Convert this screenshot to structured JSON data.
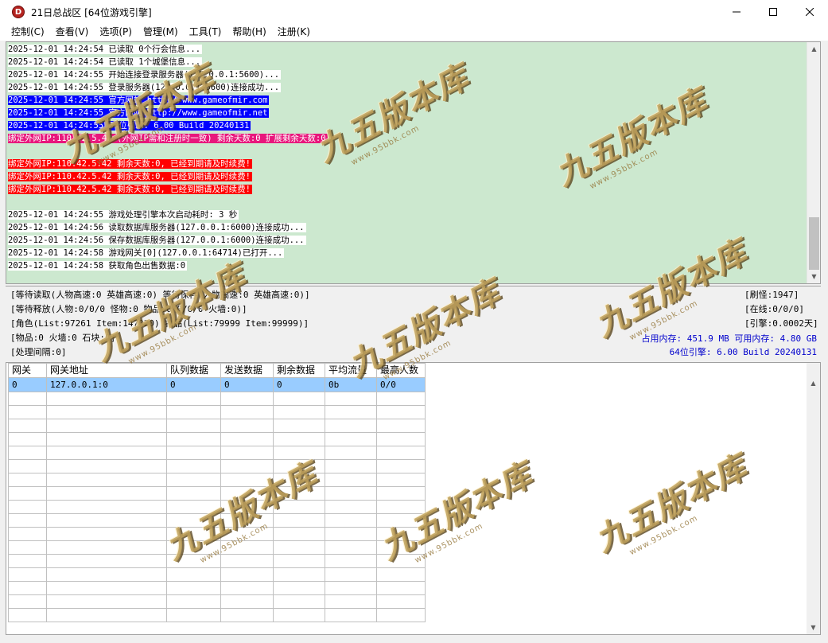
{
  "window": {
    "icon_letter": "D",
    "title": "21日总战区 [64位游戏引擎]"
  },
  "menu": [
    "控制(C)",
    "查看(V)",
    "选项(P)",
    "管理(M)",
    "工具(T)",
    "帮助(H)",
    "注册(K)"
  ],
  "log": [
    {
      "style": "normal",
      "text": "2025-12-01 14:24:54 已读取 0个行会信息..."
    },
    {
      "style": "normal",
      "text": "2025-12-01 14:24:54 已读取 1个城堡信息..."
    },
    {
      "style": "normal",
      "text": "2025-12-01 14:24:55 开始连接登录服务器(127.0.0.1:5600)..."
    },
    {
      "style": "normal",
      "text": "2025-12-01 14:24:55 登录服务器(127.0.0.1:5600)连接成功..."
    },
    {
      "style": "blue",
      "text": "2025-12-01 14:24:55 官方网站 http://www.gameofmir.com"
    },
    {
      "style": "blue",
      "text": "2025-12-01 14:24:55 官方网站 http://www.gameofmir.net"
    },
    {
      "style": "blue",
      "text": "2025-12-01 14:24:55 64位引擎: 6.00 Build 20240131"
    },
    {
      "style": "pink",
      "text": "绑定外网IP:110.42.5.42 (外网IP需和注册时一致) 剩余天数:0 扩展剩余天数:0"
    },
    {
      "style": "blank",
      "text": ""
    },
    {
      "style": "red",
      "text": "绑定外网IP:110.42.5.42 剩余天数:0, 已经到期请及时续费!"
    },
    {
      "style": "red",
      "text": "绑定外网IP:110.42.5.42 剩余天数:0, 已经到期请及时续费!"
    },
    {
      "style": "red",
      "text": "绑定外网IP:110.42.5.42 剩余天数:0, 已经到期请及时续费!"
    },
    {
      "style": "blank",
      "text": ""
    },
    {
      "style": "normal",
      "text": "2025-12-01 14:24:55 游戏处理引擎本次启动耗时: 3 秒"
    },
    {
      "style": "normal",
      "text": "2025-12-01 14:24:56 读取数据库服务器(127.0.0.1:6000)连接成功..."
    },
    {
      "style": "normal",
      "text": "2025-12-01 14:24:56 保存数据库服务器(127.0.0.1:6000)连接成功..."
    },
    {
      "style": "normal",
      "text": "2025-12-01 14:24:58 游戏网关[0](127.0.0.1:64714)已打开..."
    },
    {
      "style": "normal",
      "text": "2025-12-01 14:24:58 获取角色出售数据:0"
    }
  ],
  "status": {
    "line1": "[等待读取(人物高速:0 英雄高速:0) 等待保存(人物高速:0 英雄高速:0)]",
    "line2": "[等待释放(人物:0/0/0 怪物:0 物品:0/0/0/0 火墙:0)]",
    "line3": "[角色(List:97261 Item:147020) 物品(List:79999 Item:99999)]",
    "line4": "[物品:0 火墙:0 石块:0]",
    "line5": "[处理间隔:0]",
    "monsters": "[刷怪:1947]",
    "online": "[在线:0/0/0]",
    "engine_time": "[引擎:0.0002天]",
    "memory": "占用内存: 451.9 MB 可用内存: 4.80 GB",
    "build": "64位引擎: 6.00 Build 20240131"
  },
  "grid": {
    "columns": [
      "网关",
      "网关地址",
      "队列数据",
      "发送数据",
      "剩余数据",
      "平均流量",
      "最高人数"
    ],
    "rows": [
      [
        "0",
        "127.0.0.1:0",
        "0",
        "0",
        "0",
        "0b",
        "0/0"
      ]
    ]
  },
  "watermark": {
    "main": "九五版本库",
    "sub": "www.95bbk.com"
  }
}
